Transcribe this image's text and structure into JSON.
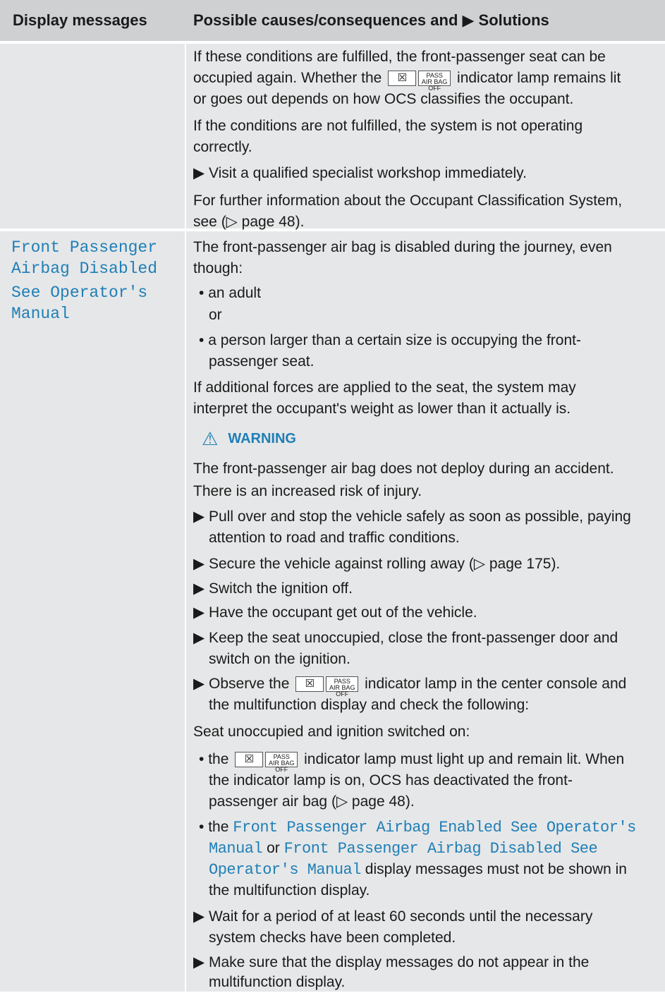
{
  "header": {
    "col1": "Display messages",
    "col2": "Possible causes/consequences and ▶ Solutions"
  },
  "row1": {
    "p1a": "If these conditions are fulfilled, the front-passenger seat can be",
    "p1b_pre": "occupied again. Whether the",
    "p1b_post": "indicator lamp remains lit",
    "p1c": "or goes out depends on how OCS classifies the occupant.",
    "p2a": "If the conditions are not fulfilled, the system is not operating",
    "p2b": "correctly.",
    "s1": "Visit a qualified specialist workshop immediately.",
    "p3a": "For further information about the Occupant Classification System,",
    "p3b": "see (▷ page 48)."
  },
  "row2_left": [
    "Front Passenger",
    "Airbag Disabled",
    "See Operator's",
    "Manual"
  ],
  "row2": {
    "p1a": "The front-passenger air bag is disabled during the journey, even",
    "p1b": "though:",
    "b1": "an adult",
    "or": "or",
    "b2a": "a person larger than a certain size is occupying the front-",
    "b2b": "passenger seat.",
    "p2a": "If additional forces are applied to the seat, the system may",
    "p2b": "interpret the occupant's weight as lower than it actually is.",
    "warning": "WARNING",
    "w1": "The front-passenger air bag does not deploy during an accident.",
    "w2": "There is an increased risk of injury.",
    "s1a": "Pull over and stop the vehicle safely as soon as possible, paying",
    "s1b": "attention to road and traffic conditions.",
    "s2": "Secure the vehicle against rolling away (▷ page 175).",
    "s3": "Switch the ignition off.",
    "s4": "Have the occupant get out of the vehicle.",
    "s5a": "Keep the seat unoccupied, close the front-passenger door and",
    "s5b": "switch on the ignition.",
    "s6a_pre": "Observe the",
    "s6a_post": "indicator lamp in the center console and",
    "s6b": "the multifunction display and check the following:",
    "p3": "Seat unoccupied and ignition switched on:",
    "c1a_pre": "the",
    "c1a_post": "indicator lamp must light up and remain lit. When",
    "c1b": "the indicator lamp is on, OCS has deactivated the front-",
    "c1c": "passenger air bag (▷ page 48).",
    "c2a_pre": "the",
    "c2a_msg": "Front Passenger Airbag Enabled See Operator's",
    "c2b_msg1": "Manual",
    "c2b_or": "or",
    "c2b_msg2": "Front Passenger Airbag Disabled See",
    "c2c_msg": "Operator's Manual",
    "c2c_post": "display messages must not be shown in",
    "c2d": "the multifunction display.",
    "s7a": "Wait for a period of at least 60 seconds until the necessary",
    "s7b": "system checks have been completed.",
    "s8a": "Make sure that the display messages do not appear in the",
    "s8b": "multifunction display."
  },
  "icons": {
    "action_marker": "▶",
    "bullet": "•",
    "warning_icon": "⚠",
    "lamp_symbol": "☒",
    "lamp_text_top": "PASS",
    "lamp_text_bottom": "AIR BAG OFF"
  },
  "colors": {
    "header_bg": "#cfd0d2",
    "cell_bg": "#e6e7e8",
    "message_blue": "#1f7fb7"
  }
}
